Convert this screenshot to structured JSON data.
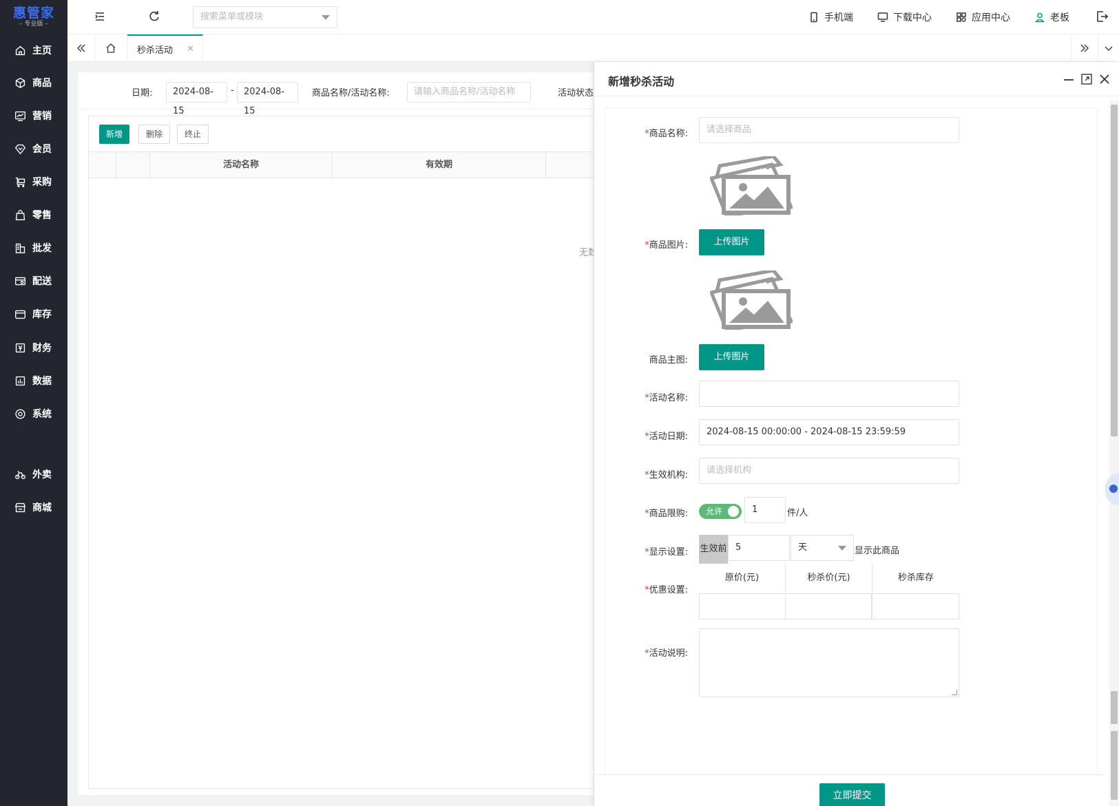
{
  "brand": {
    "name": "惠管家",
    "edition": "专业版",
    "color": "#3b6cf6"
  },
  "sidebar": {
    "items": [
      {
        "label": "主页",
        "icon": "home-icon"
      },
      {
        "label": "商品",
        "icon": "box-icon"
      },
      {
        "label": "营销",
        "icon": "chart-icon"
      },
      {
        "label": "会员",
        "icon": "diamond-icon"
      },
      {
        "label": "采购",
        "icon": "cart-icon"
      },
      {
        "label": "零售",
        "icon": "bag-icon"
      },
      {
        "label": "批发",
        "icon": "building-icon"
      },
      {
        "label": "配送",
        "icon": "truck-icon"
      },
      {
        "label": "库存",
        "icon": "warehouse-icon"
      },
      {
        "label": "财务",
        "icon": "yuan-icon"
      },
      {
        "label": "数据",
        "icon": "data-icon"
      },
      {
        "label": "系统",
        "icon": "settings-icon"
      },
      {
        "label": "外卖",
        "icon": "bike-icon"
      },
      {
        "label": "商城",
        "icon": "shop-icon"
      }
    ]
  },
  "header": {
    "search_placeholder": "搜索菜单或模块",
    "links": [
      {
        "label": "手机端",
        "icon": "mobile-icon"
      },
      {
        "label": "下载中心",
        "icon": "monitor-icon"
      },
      {
        "label": "应用中心",
        "icon": "apps-icon"
      },
      {
        "label": "老板",
        "icon": "user-icon"
      }
    ]
  },
  "tabs": {
    "active": "秒杀活动"
  },
  "filters": {
    "date_label": "日期:",
    "date_start": "2024-08-15",
    "date_sep": "-",
    "date_end": "2024-08-15",
    "name_label": "商品名称/活动名称:",
    "name_placeholder": "请输入商品名称/活动名称",
    "status_label": "活动状态"
  },
  "toolbar": {
    "add": "新增",
    "delete": "删除",
    "stop": "终止"
  },
  "table": {
    "columns": [
      "",
      "",
      "活动名称",
      "有效期"
    ],
    "empty_text": "无数"
  },
  "drawer": {
    "title": "新增秒杀活动",
    "fields": {
      "product_name": {
        "label": "商品名称:",
        "placeholder": "请选择商品",
        "required": true
      },
      "product_image": {
        "label": "商品图片:",
        "button": "上传图片",
        "required": true
      },
      "main_image": {
        "label": "商品主图:",
        "button": "上传图片",
        "required": false
      },
      "activity_name": {
        "label": "活动名称:",
        "value": "",
        "required": true
      },
      "activity_date": {
        "label": "活动日期:",
        "value": "2024-08-15 00:00:00 - 2024-08-15 23:59:59",
        "required": true
      },
      "org": {
        "label": "生效机构:",
        "placeholder": "请选择机构",
        "required": true
      },
      "limit": {
        "label": "商品限购:",
        "switch_label": "允许",
        "switch_on": true,
        "value": "1",
        "unit": "件/人",
        "required": true
      },
      "display": {
        "label": "显示设置:",
        "prefix": "生效前",
        "value": "5",
        "unit_select": "天",
        "suffix": "显示此商品",
        "required": true
      },
      "discount": {
        "label": "优惠设置:",
        "columns": [
          "原价(元)",
          "秒杀价(元)",
          "秒杀库存"
        ],
        "required": true
      },
      "description": {
        "label": "活动说明:",
        "required": true
      }
    },
    "submit": "立即提交"
  },
  "colors": {
    "primary": "#009688",
    "sidebar": "#23262e",
    "switch_on": "#5fb878",
    "required": "#e33"
  }
}
